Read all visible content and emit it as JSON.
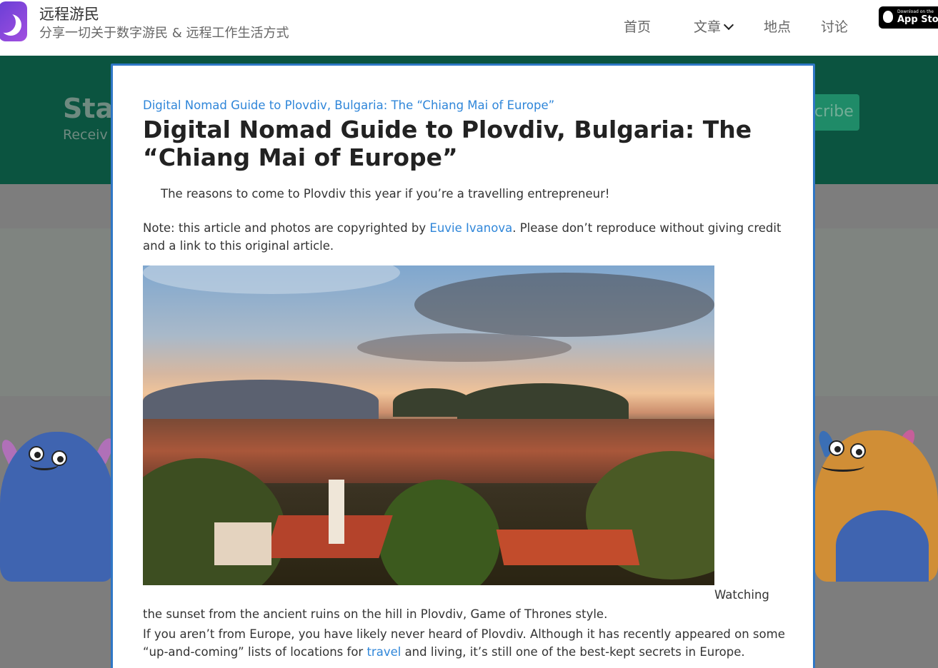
{
  "header": {
    "brand_title": "远程游民",
    "brand_subtitle": "分享一切关于数字游民 & 远程工作生活方式",
    "nav": [
      "首页",
      "文章",
      "地点",
      "讨论"
    ],
    "appstore_small": "Download on the",
    "appstore_big": "App Store"
  },
  "banner": {
    "title": "Stay",
    "subtitle": "Receiv",
    "subscribe_label": "cribe"
  },
  "modal": {
    "breadcrumb_link": "Digital Nomad Guide to Plovdiv, Bulgaria: The “Chiang Mai of Europe”",
    "title": "Digital Nomad Guide to Plovdiv, Bulgaria: The “Chiang Mai of Europe”",
    "subtitle": "The reasons to come to Plovdiv this year if you’re a travelling entrepreneur!",
    "note_before": "Note: this article and photos are copyrighted by ",
    "note_author": "Euvie Ivanova",
    "note_after": ". Please don’t reproduce without giving credit and a link to this original article.",
    "photo_alt": "Sunset over Plovdiv rooftops and hills",
    "caption_part1": "Watching",
    "caption_part2": "the sunset from the ancient ruins on the hill in Plovdiv, Game of Thrones style.",
    "para_before": "If you aren’t from Europe, you have likely never heard of Plovdiv. Although it has recently appeared on some “up-and-coming” lists of locations for ",
    "para_link": "travel",
    "para_after": " and living, it’s still one of the best-kept secrets in Europe."
  },
  "colors": {
    "banner_green": "#0b5440",
    "modal_border": "#2f77c6",
    "link_blue": "#2f86d9",
    "backdrop_gray": "#7d7d7d"
  }
}
